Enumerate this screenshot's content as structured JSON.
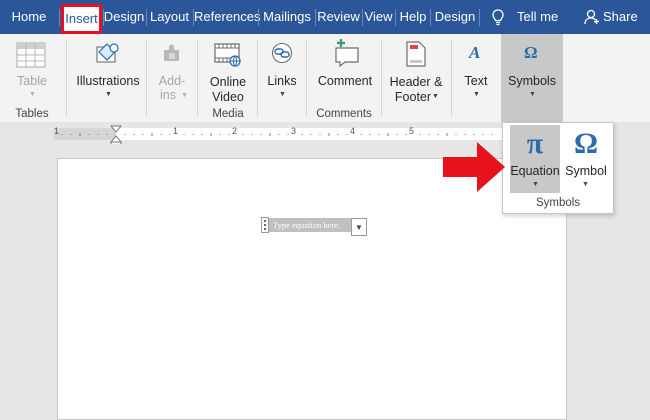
{
  "tabs": [
    {
      "label": "Home"
    },
    {
      "label": "Insert"
    },
    {
      "label": "Design"
    },
    {
      "label": "Layout"
    },
    {
      "label": "References"
    },
    {
      "label": "Mailings"
    },
    {
      "label": "Review"
    },
    {
      "label": "View"
    },
    {
      "label": "Help"
    },
    {
      "label": "Design"
    }
  ],
  "tell_me": "Tell me",
  "share": "Share",
  "ribbon": {
    "tables": {
      "button": "Table",
      "group": "Tables"
    },
    "illustrations": {
      "button": "Illustrations"
    },
    "addins": {
      "line1": "Add-",
      "line2": "ins"
    },
    "media": {
      "line1": "Online",
      "line2": "Video",
      "group": "Media"
    },
    "links": {
      "button": "Links"
    },
    "comments": {
      "button": "Comment",
      "group": "Comments"
    },
    "header_footer": {
      "line1": "Header &",
      "line2": "Footer"
    },
    "text": {
      "button": "Text"
    },
    "symbols": {
      "button": "Symbols"
    }
  },
  "flyout": {
    "equation": {
      "glyph": "π",
      "label": "Equation"
    },
    "symbol": {
      "glyph": "Ω",
      "label": "Symbol"
    },
    "group": "Symbols"
  },
  "ruler_numbers": [
    "1",
    "1",
    "2",
    "3",
    "4",
    "5"
  ],
  "equation_placeholder": "Type equation here.",
  "colors": {
    "accent": "#2b579a",
    "highlight": "#e81123",
    "arrow": "#e8121c"
  }
}
